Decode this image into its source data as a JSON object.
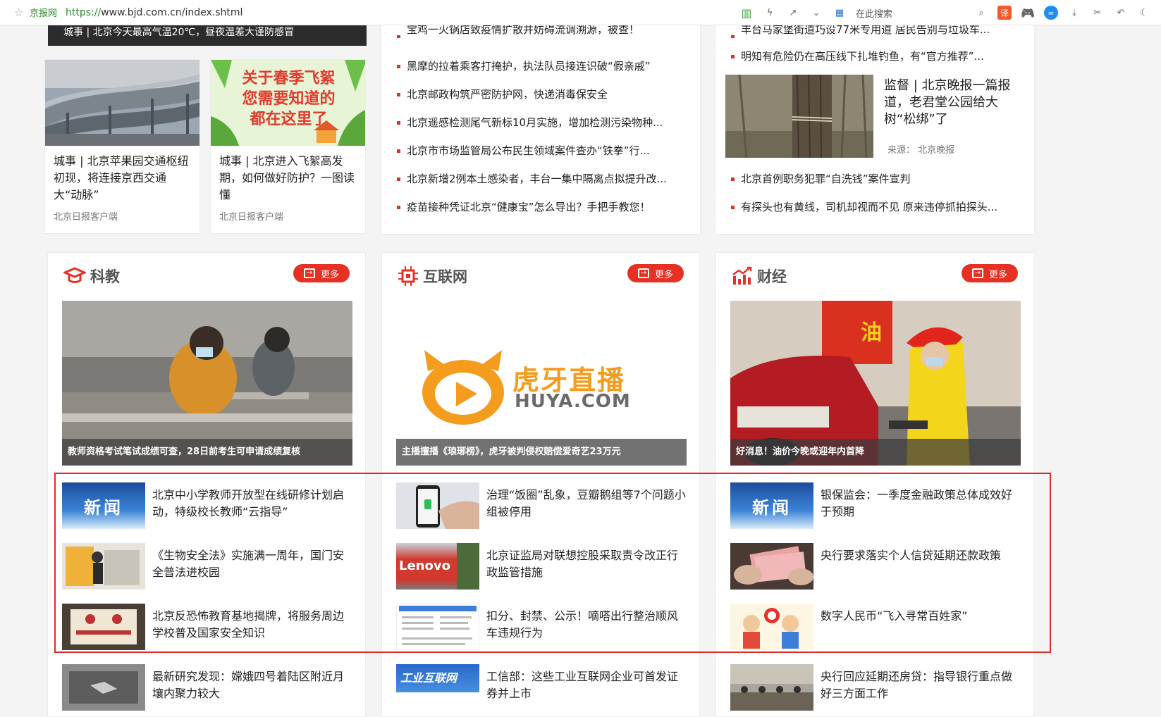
{
  "browser": {
    "site_name": "京报网",
    "url_scheme": "https://",
    "url_rest": "www.bjd.com.cn/index.shtml",
    "search_placeholder": "在此搜索",
    "translate_icon_label": "译"
  },
  "top_strip": {
    "text": "城事 | 北京今天最高气温20℃，昼夜温差大谨防感冒"
  },
  "col2_top_list": [
    "宝鸡一火锅店致疫情扩散并妨碍流调溯源，被查！",
    "黑摩的拉着乘客打掩护，执法队员接连识破“假亲戚”",
    "北京邮政构筑严密防护网，快递消毒保安全",
    "北京遥感检测尾气新标10月实施，增加检测污染物种...",
    "北京市市场监管局公布民生领域案件查办“铁拳”行...",
    "北京新增2例本土感染者，丰台一集中隔离点拟提升改...",
    "疫苗接种凭证北京“健康宝”怎么导出？手把手教您！"
  ],
  "col3_top_list": [
    "丰台马家堡街道巧设77米专用道 居民告别与垃圾车...",
    "明知有危险仍在高压线下扎堆钓鱼，有“官方推荐”..."
  ],
  "col3_feature": {
    "title": "监督 | 北京晚报一篇报道，老君堂公园给大树“松绑”了",
    "source_label": "来源：",
    "source": "北京晚报"
  },
  "col3_bottom_list": [
    "北京首例职务犯罪“自洗钱”案件宣判",
    "有探头也有黄线，司机却视而不见 原来违停抓拍探头..."
  ],
  "thumb_cards": [
    {
      "title": "城事 | 北京苹果园交通枢纽初现，将连接京西交通大“动脉”",
      "source": "北京日报客户端"
    },
    {
      "title": "城事 | 北京进入飞絮高发期，如何做好防护？一图读懂",
      "source": "北京日报客户端",
      "poster_text": [
        "关于春季飞絮",
        "您需要知道的",
        "都在这里了"
      ]
    }
  ],
  "more_label": "更多",
  "sections": [
    {
      "name": "科教",
      "photo_caption": "教师资格考试笔试成绩可查，28日前考生可申请成绩复核",
      "items": [
        {
          "text": "北京中小学教师开放型在线研修计划启动，特级校长教师“云指导”",
          "thumb": "新闻"
        },
        {
          "text": "《生物安全法》实施满一周年，国门安全普法进校园",
          "thumb": ""
        },
        {
          "text": "北京反恐怖教育基地揭牌，将服务周边学校普及国家安全知识",
          "thumb": ""
        },
        {
          "text": "最新研究发现：嫦娥四号着陆区附近月壤内聚力较大",
          "thumb": ""
        }
      ]
    },
    {
      "name": "互联网",
      "photo_caption": "主播擅播《琅琊榜》，虎牙被判侵权赔偿爱奇艺23万元",
      "logo_cn": "虎牙直播",
      "logo_en": "HUYA.COM",
      "items": [
        {
          "text": "治理“饭圈”乱象，豆瓣鹅组等7个问题小组被停用",
          "thumb": ""
        },
        {
          "text": "北京证监局对联想控股采取责令改正行政监管措施",
          "thumb": "Lenovo"
        },
        {
          "text": "扣分、封禁、公示！嘀嗒出行整治顺风车违规行为",
          "thumb": ""
        },
        {
          "text": "工信部：这些工业互联网企业可首发证券并上市",
          "thumb": "工业互联网"
        }
      ]
    },
    {
      "name": "财经",
      "photo_caption": "好消息！油价今晚或迎年内首降",
      "sign_text": "油",
      "items": [
        {
          "text": "银保监会：一季度金融政策总体成效好于预期",
          "thumb": "新闻"
        },
        {
          "text": "央行要求落实个人信贷延期还款政策",
          "thumb": ""
        },
        {
          "text": "数字人民币“飞入寻常百姓家”",
          "thumb": ""
        },
        {
          "text": "央行回应延期还房贷：指导银行重点做好三方面工作",
          "thumb": ""
        }
      ]
    }
  ],
  "colors": {
    "accent_red": "#e63024",
    "highlight_border": "#e02a2a",
    "url_green": "#2a8a2a"
  }
}
